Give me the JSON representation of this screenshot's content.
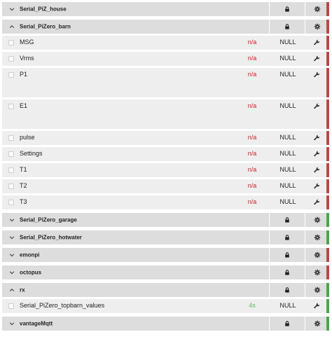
{
  "colors": {
    "status_red": "#b94a48",
    "status_green": "#4ca64c",
    "time_na": "#cc2222",
    "time_ok": "#5cb85c"
  },
  "icons": {
    "expanded": "chevron-up-icon",
    "collapsed": "chevron-down-icon",
    "lock": "lock-icon",
    "settings": "gear-icon",
    "edit": "wrench-icon"
  },
  "nodes": [
    {
      "name": "Serial_PiZ_house",
      "expanded": false,
      "status": "red",
      "feeds": []
    },
    {
      "name": "Serial_PiZero_barn",
      "expanded": true,
      "status": "red",
      "feeds": [
        {
          "name": "MSG",
          "time": "n/a",
          "value": "NULL"
        },
        {
          "name": "Vrms",
          "time": "n/a",
          "value": "NULL"
        },
        {
          "name": "P1",
          "time": "n/a",
          "value": "NULL",
          "tall": true
        },
        {
          "name": "E1",
          "time": "n/a",
          "value": "NULL",
          "tall": true
        },
        {
          "name": "pulse",
          "time": "n/a",
          "value": "NULL"
        },
        {
          "name": "Settings",
          "time": "n/a",
          "value": "NULL"
        },
        {
          "name": "T1",
          "time": "n/a",
          "value": "NULL"
        },
        {
          "name": "T2",
          "time": "n/a",
          "value": "NULL"
        },
        {
          "name": "T3",
          "time": "n/a",
          "value": "NULL"
        }
      ]
    },
    {
      "name": "Serial_PiZero_garage",
      "expanded": false,
      "status": "green",
      "feeds": []
    },
    {
      "name": "Serial_PiZero_hotwater",
      "expanded": false,
      "status": "green",
      "feeds": []
    },
    {
      "name": "emonpi",
      "expanded": false,
      "status": "red",
      "feeds": []
    },
    {
      "name": "octopus",
      "expanded": false,
      "status": "red",
      "feeds": []
    },
    {
      "name": "rx",
      "expanded": true,
      "status": "green",
      "feeds": [
        {
          "name": "Serial_PiZero_topbarn_values",
          "time": "4s",
          "value": "NULL"
        }
      ]
    },
    {
      "name": "vantageMqtt",
      "expanded": false,
      "status": "green",
      "feeds": []
    }
  ]
}
